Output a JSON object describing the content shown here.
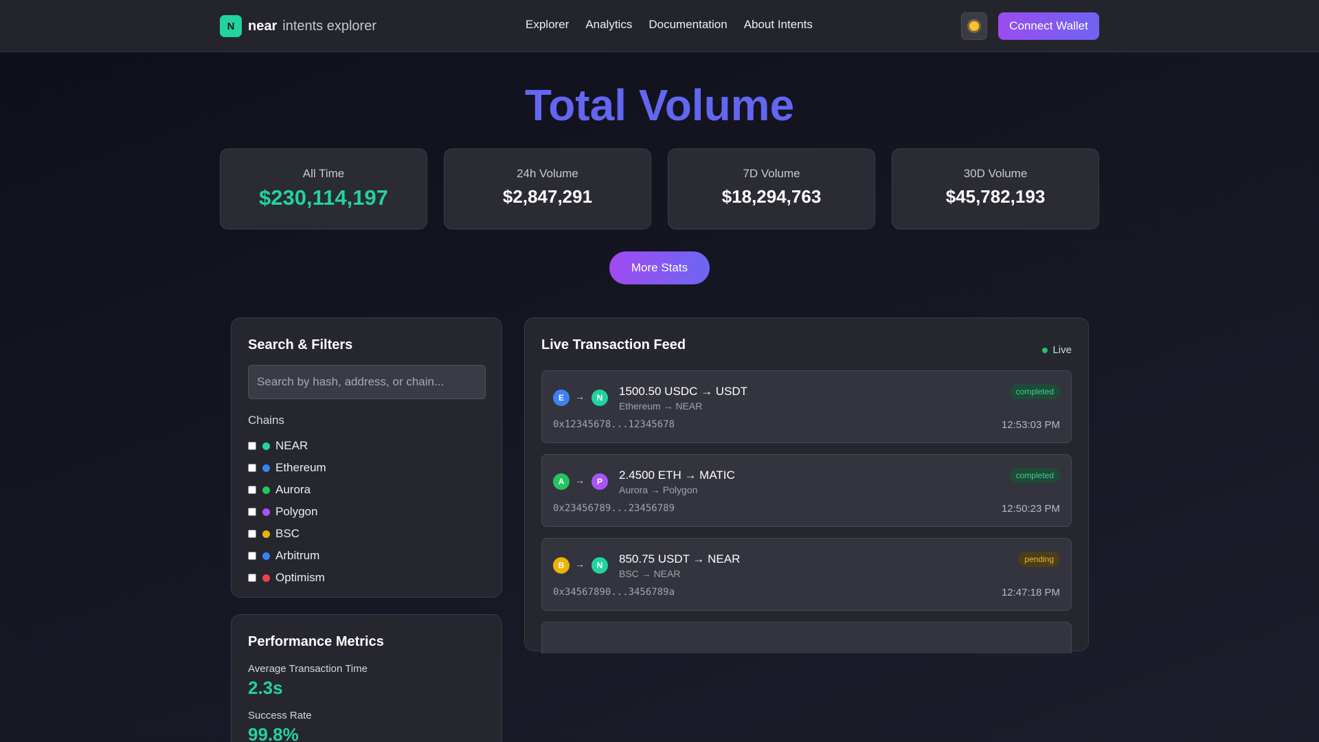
{
  "header": {
    "logo_letter": "N",
    "brand_name": "near",
    "brand_sub": "intents explorer",
    "nav": [
      "Explorer",
      "Analytics",
      "Documentation",
      "About Intents"
    ],
    "theme_icon": "sun-icon",
    "connect_label": "Connect Wallet"
  },
  "hero": {
    "title": "Total Volume",
    "stats": [
      {
        "label": "All Time",
        "value": "$230,114,197"
      },
      {
        "label": "24h Volume",
        "value": "$2,847,291"
      },
      {
        "label": "7D Volume",
        "value": "$18,294,763"
      },
      {
        "label": "30D Volume",
        "value": "$45,782,193"
      }
    ],
    "more_label": "More Stats"
  },
  "filters": {
    "title": "Search & Filters",
    "placeholder": "Search by hash, address, or chain...",
    "chains_label": "Chains",
    "chains": [
      {
        "name": "NEAR",
        "color": "#22d3a0"
      },
      {
        "name": "Ethereum",
        "color": "#3b82f6"
      },
      {
        "name": "Aurora",
        "color": "#22c55e"
      },
      {
        "name": "Polygon",
        "color": "#a855f7"
      },
      {
        "name": "BSC",
        "color": "#eab308"
      },
      {
        "name": "Arbitrum",
        "color": "#3b82f6"
      },
      {
        "name": "Optimism",
        "color": "#ef4444"
      }
    ]
  },
  "metrics": {
    "title": "Performance Metrics",
    "items": [
      {
        "label": "Average Transaction Time",
        "value": "2.3s"
      },
      {
        "label": "Success Rate",
        "value": "99.8%"
      }
    ]
  },
  "feed": {
    "title": "Live Transaction Feed",
    "live_label": "Live",
    "transactions": [
      {
        "from": "E",
        "from_color": "#3b82f6",
        "to": "N",
        "to_color": "#22d3a0",
        "arrow": "→",
        "title": "1500.50 USDC → USDT",
        "route": "Ethereum → NEAR",
        "hash": "0x12345678...12345678",
        "time": "12:53:03 PM",
        "status": "completed"
      },
      {
        "from": "A",
        "from_color": "#22c55e",
        "to": "P",
        "to_color": "#a855f7",
        "arrow": "→",
        "title": "2.4500 ETH → MATIC",
        "route": "Aurora → Polygon",
        "hash": "0x23456789...23456789",
        "time": "12:50:23 PM",
        "status": "completed"
      },
      {
        "from": "B",
        "from_color": "#eab308",
        "to": "N",
        "to_color": "#22d3a0",
        "arrow": "→",
        "title": "850.75 USDT → NEAR",
        "route": "BSC → NEAR",
        "hash": "0x34567890...3456789a",
        "time": "12:47:18 PM",
        "status": "pending"
      },
      {
        "from": "",
        "from_color": "#33343d",
        "to": "",
        "to_color": "#33343d",
        "arrow": "",
        "title": "",
        "route": "",
        "hash": "",
        "time": "",
        "status": ""
      }
    ]
  }
}
